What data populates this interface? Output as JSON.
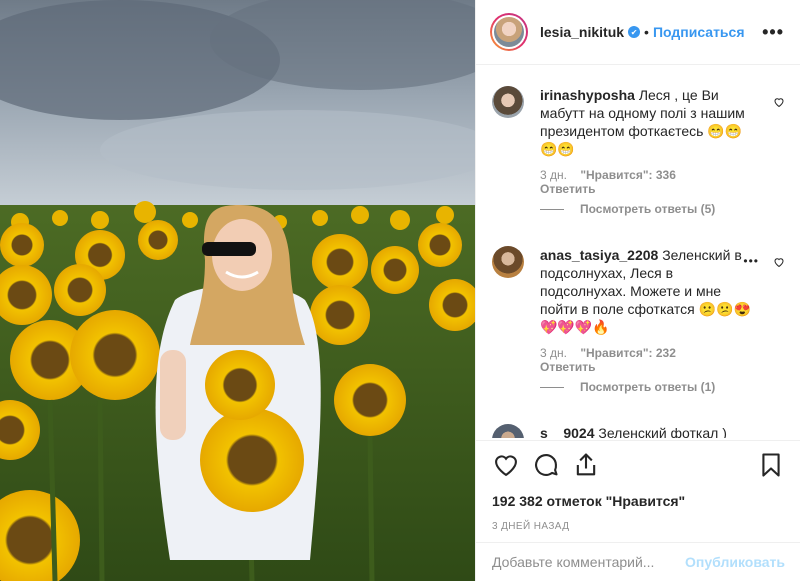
{
  "post": {
    "username": "lesia_nikituk",
    "verified_mark": "✔",
    "follow_label": "Подписаться",
    "dot": "•",
    "more_label": "•••",
    "likes_text": "192 382 отметок \"Нравится\"",
    "timestamp": "3 ДНЕЙ НАЗАД",
    "comment_placeholder": "Добавьте комментарий...",
    "publish_label": "Опубликовать"
  },
  "comments": [
    {
      "username": "irinashyposha",
      "text": "Леся , це Ви мабутт на одному полі з нашим президентом фоткаєтесь 😁😁😁😁",
      "time": "3 дн.",
      "likes": "\"Нравится\": 336",
      "reply_label": "Ответить",
      "replies_label": "Посмотреть ответы (5)"
    },
    {
      "username": "anas_tasiya_2208",
      "text": "Зеленский в подсолнухах, Леся в подсолнухах. Можете и мне пойти в поле сфоткатся 😕😕😍💖💖💖🔥",
      "time": "3 дн.",
      "likes": "\"Нравится\": 232",
      "reply_label": "Ответить",
      "replies_label": "Посмотреть ответы (1)",
      "more_label": "•••"
    },
    {
      "username": "s__9024",
      "text": "Зеленский фоткал )"
    }
  ],
  "icons": {
    "like": "heart-icon",
    "comment": "comment-icon",
    "share": "share-icon",
    "save": "bookmark-icon"
  },
  "colors": {
    "accent": "#3897f0",
    "muted": "#8e8e8e",
    "border": "#efefef",
    "publish_disabled": "#b2dffc"
  }
}
